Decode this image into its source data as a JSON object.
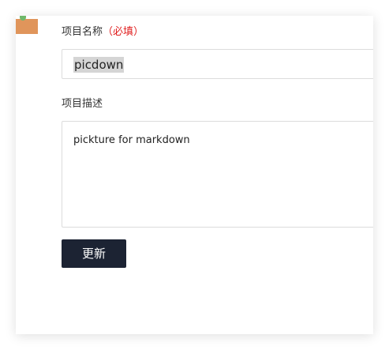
{
  "form": {
    "name_label": "项目名称",
    "required_marker": "（必填）",
    "name_value": "picdown",
    "desc_label": "项目描述",
    "desc_value": "pickture for markdown",
    "submit_label": "更新"
  },
  "colors": {
    "required": "#e02020",
    "button_bg": "#1c2333",
    "border": "#dcdcdc",
    "selection": "#d5d5d5"
  }
}
